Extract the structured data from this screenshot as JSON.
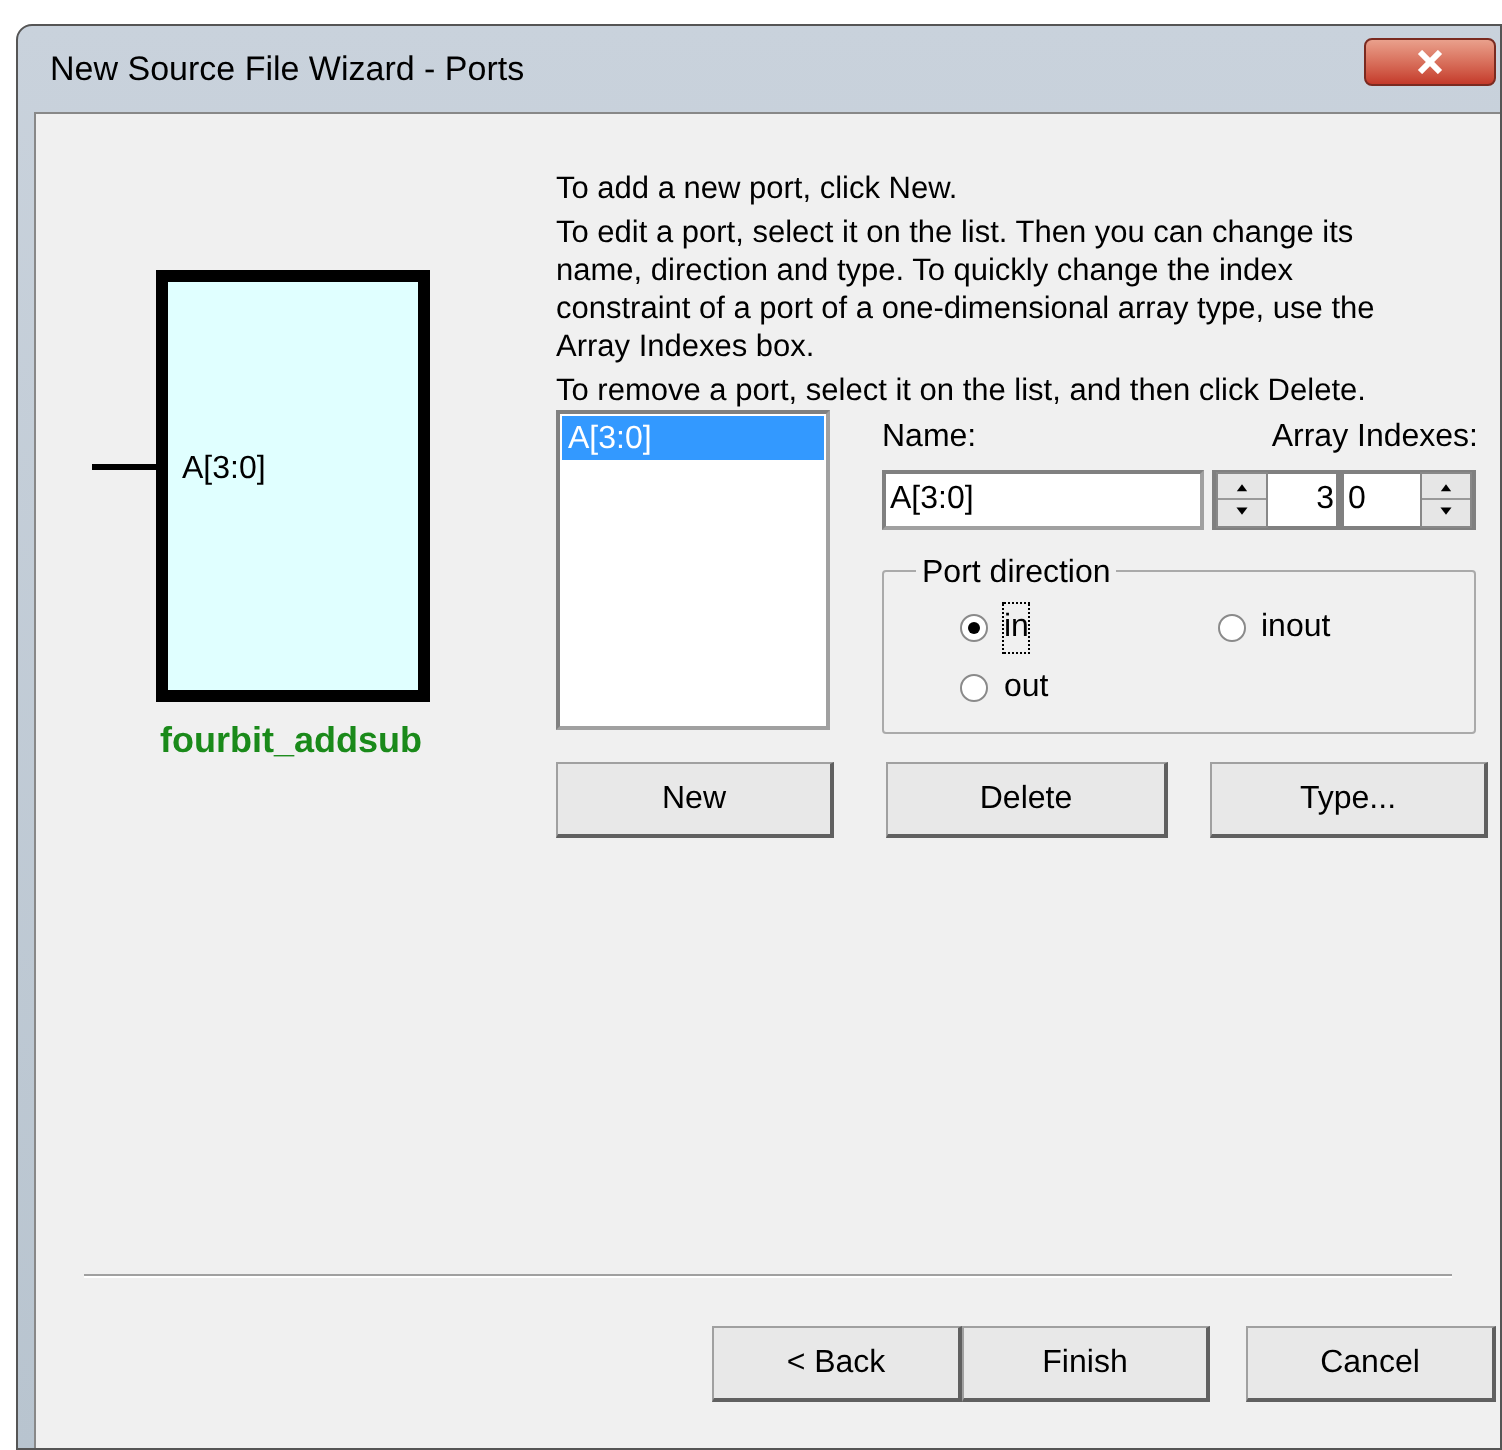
{
  "window": {
    "title": "New Source File Wizard - Ports"
  },
  "symbol": {
    "name": "fourbit_addsub",
    "ports": [
      {
        "label": "A[3:0]"
      }
    ]
  },
  "instructions": [
    "To add a new port, click New.",
    "To edit a port, select it on the list. Then you can change its name, direction and type. To quickly change the index constraint of a port of a one-dimensional array type, use the Array Indexes box.",
    "To remove a port, select it on the list, and then click Delete."
  ],
  "port_list": [
    {
      "label": "A[3:0]",
      "selected": true
    }
  ],
  "name_field": {
    "label": "Name:",
    "value": "A[3:0]"
  },
  "array_indexes": {
    "label": "Array Indexes:",
    "high": "3",
    "low": "0"
  },
  "port_direction": {
    "title": "Port direction",
    "options": [
      {
        "label": "in",
        "selected": true
      },
      {
        "label": "inout",
        "selected": false
      },
      {
        "label": "out",
        "selected": false
      }
    ]
  },
  "list_buttons": [
    "New",
    "Delete",
    "Type..."
  ],
  "footer_buttons": [
    "< Back",
    "Finish",
    "Cancel"
  ]
}
